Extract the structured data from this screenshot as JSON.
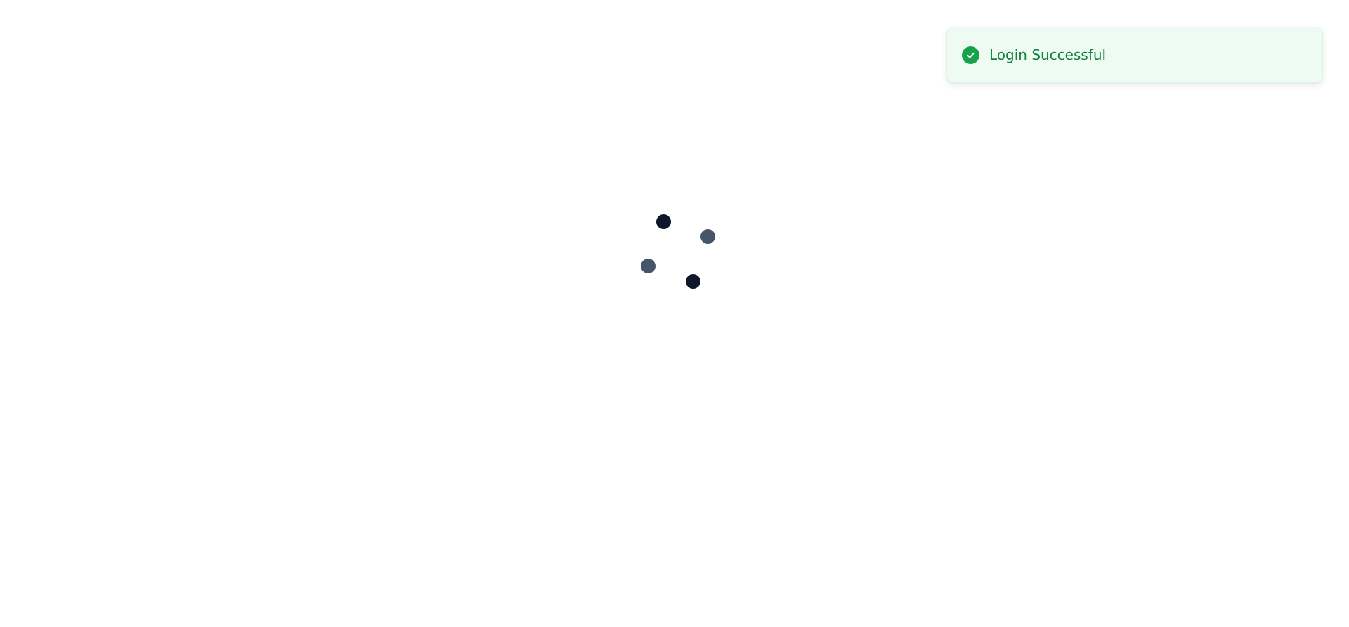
{
  "notification": {
    "message": "Login Successful",
    "icon": "check-circle-icon",
    "status": "success"
  },
  "loading_indicator": {
    "icon": "loading-spinner-icon",
    "state": "loading"
  }
}
